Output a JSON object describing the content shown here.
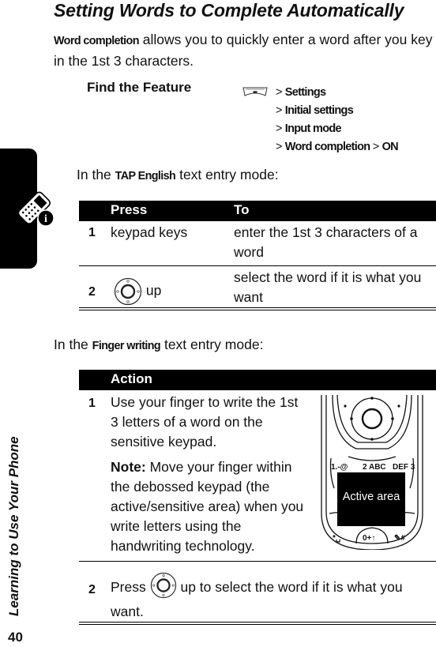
{
  "page": {
    "title": "Setting Words to Complete Automatically",
    "intro": {
      "term": "Word completion",
      "text": " allows you to quickly enter a word after you key in the 1st 3 characters."
    },
    "find_feature": {
      "label": "Find the Feature",
      "icon": "menu-key-icon",
      "path": [
        "Settings",
        "Initial settings",
        "Input mode",
        "Word completion"
      ],
      "final_value": "ON",
      "separator": ">"
    },
    "section1": {
      "prefix": "In the ",
      "mode": "TAP English",
      "suffix": " text entry mode:",
      "table": {
        "headers": [
          "Press",
          "To"
        ],
        "rows": [
          {
            "num": "1",
            "press": "keypad keys",
            "to": "enter the 1st 3 characters of a word"
          },
          {
            "num": "2",
            "press_icon": "nav-key-icon",
            "press": "up",
            "to": "select the word if it is what you want"
          }
        ]
      }
    },
    "section2": {
      "prefix": "In the ",
      "mode": "Finger writing",
      "suffix": " text entry mode:",
      "table": {
        "headers": [
          "Action"
        ],
        "rows": [
          {
            "num": "1",
            "text": "Use your finger to write the 1st 3 letters of a word on the sensitive keypad.",
            "note_label": "Note:",
            "note": " Move your finger within the debossed keypad (the active/sensitive area) when you write letters using the handwriting technology."
          },
          {
            "num": "2",
            "text_before": "Press ",
            "icon": "nav-key-icon",
            "text_after": " up to select the word if it is what you want."
          }
        ],
        "image_caption": "Active area",
        "keypad_labels": [
          "1.-@",
          "2 ABC",
          "DEF 3",
          "*␣",
          "0+↑",
          "✎#"
        ]
      }
    },
    "sidebar": {
      "chapter": "Learning to Use Your Phone",
      "icon": "phone-info-icon"
    },
    "page_number": "40"
  }
}
